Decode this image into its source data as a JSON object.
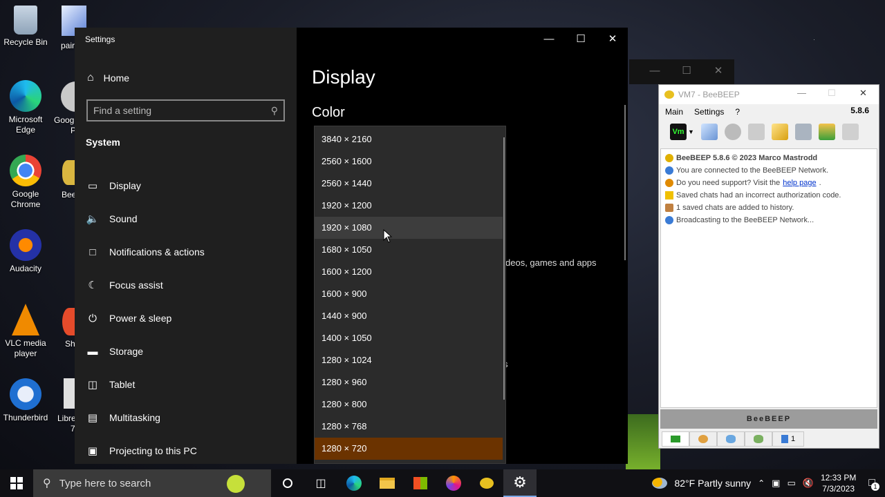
{
  "desktop": {
    "icons": [
      {
        "label": "Recycle Bin"
      },
      {
        "label": "Microsoft Edge"
      },
      {
        "label": "Google Chrome"
      },
      {
        "label": "Audacity"
      },
      {
        "label": "VLC media player"
      },
      {
        "label": "Thunderbird"
      }
    ],
    "partial_labels": [
      "pair",
      "Googl",
      "P",
      "Bee",
      "Sh",
      "Libre",
      "7"
    ]
  },
  "settings": {
    "window_title": "Settings",
    "home_label": "Home",
    "search_placeholder": "Find a setting",
    "group_label": "System",
    "nav": [
      {
        "label": "Display",
        "icon": "monitor-icon"
      },
      {
        "label": "Sound",
        "icon": "speaker-icon"
      },
      {
        "label": "Notifications & actions",
        "icon": "notification-icon"
      },
      {
        "label": "Focus assist",
        "icon": "moon-icon"
      },
      {
        "label": "Power & sleep",
        "icon": "power-icon"
      },
      {
        "label": "Storage",
        "icon": "storage-icon"
      },
      {
        "label": "Tablet",
        "icon": "tablet-icon"
      },
      {
        "label": "Multitasking",
        "icon": "multitasking-icon"
      },
      {
        "label": "Projecting to this PC",
        "icon": "projector-icon"
      }
    ],
    "page_title": "Display",
    "section_title": "Color",
    "background_text": "deos, games and apps",
    "background_fragment": "s",
    "resolutions": [
      "3840 × 2160",
      "2560 × 1600",
      "2560 × 1440",
      "1920 × 1200",
      "1920 × 1080",
      "1680 × 1050",
      "1600 × 1200",
      "1600 × 900",
      "1440 × 900",
      "1400 × 1050",
      "1280 × 1024",
      "1280 × 960",
      "1280 × 800",
      "1280 × 768",
      "1280 × 720"
    ],
    "hovered_resolution": "1920 × 1080",
    "selected_resolution": "1280 × 720"
  },
  "beebeep": {
    "title": "VM7 - BeeBEEP",
    "menu": [
      "Main",
      "Settings",
      "?"
    ],
    "version": "5.8.6",
    "log": [
      {
        "text": "BeeBEEP 5.8.6 © 2023 Marco Mastrodd",
        "bold": true,
        "color": "#e0b000"
      },
      {
        "text": "You are connected to the BeeBEEP Network.",
        "color": "#3a7bd5"
      },
      {
        "text": "Do you need support? Visit the ",
        "link": "help page",
        "suffix": ".",
        "color": "#e08a00"
      },
      {
        "text": "Saved chats had an incorrect authorization code.",
        "color": "#f0c000"
      },
      {
        "text": "1 saved chats are added to history.",
        "color": "#c08040"
      },
      {
        "text": "Broadcasting to the BeeBEEP Network...",
        "color": "#3a7bd5"
      }
    ],
    "banner": "BeeBEEP",
    "tab_count": "1"
  },
  "taskbar": {
    "search_placeholder": "Type here to search",
    "weather": "82°F  Partly sunny",
    "time": "12:33 PM",
    "date": "7/3/2023",
    "notification_count": "1"
  }
}
